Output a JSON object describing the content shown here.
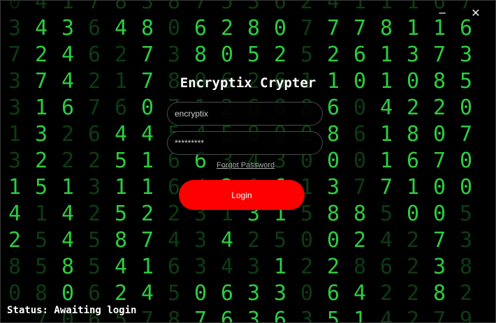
{
  "window": {
    "minimize_glyph": "─",
    "close_glyph": "✕"
  },
  "app": {
    "title": "Encryptix Crypter"
  },
  "form": {
    "username_value": "encryptix",
    "password_value": "*********",
    "forgot_label": "Forgot Password",
    "login_label": "Login"
  },
  "status": {
    "text": "Status: Awaiting login"
  },
  "background": {
    "style": "matrix digital rain",
    "colors": {
      "bright": "#2ecc40",
      "mid": "#1f8a2c",
      "dim": "#0d3b12",
      "faint": "#081f0b"
    },
    "columns": [
      {
        "glyphs": [
          "0",
          "3",
          "7",
          "3",
          "3",
          "1",
          "3",
          "1",
          "4",
          "2",
          "8",
          "0"
        ],
        "levels": [
          "f",
          "d",
          "d",
          "d",
          "d",
          "d",
          "d",
          "b",
          "b",
          "b",
          "d",
          "d"
        ]
      },
      {
        "glyphs": [
          "4",
          "4",
          "2",
          "7",
          "1",
          "3",
          "2",
          "5",
          "1",
          "5",
          "5",
          "8",
          "7"
        ],
        "levels": [
          "d",
          "b",
          "b",
          "b",
          "b",
          "b",
          "b",
          "b",
          "d",
          "d",
          "d",
          "d",
          "d"
        ]
      },
      {
        "glyphs": [
          "1",
          "3",
          "4",
          "4",
          "6",
          "2",
          "2",
          "1",
          "4",
          "4",
          "8",
          "0",
          "0"
        ],
        "levels": [
          "d",
          "b",
          "b",
          "b",
          "b",
          "d",
          "d",
          "b",
          "b",
          "b",
          "b",
          "b",
          "d"
        ]
      },
      {
        "glyphs": [
          "7",
          "6",
          "6",
          "2",
          "7",
          "6",
          "2",
          "3",
          "2",
          "5",
          "5",
          "6",
          "6"
        ],
        "levels": [
          "d",
          "d",
          "d",
          "d",
          "d",
          "d",
          "d",
          "d",
          "d",
          "d",
          "d",
          "d",
          "d"
        ]
      },
      {
        "glyphs": [
          "8",
          "4",
          "2",
          "1",
          "6",
          "4",
          "5",
          "1",
          "5",
          "8",
          "4",
          "2",
          "5"
        ],
        "levels": [
          "d",
          "b",
          "d",
          "d",
          "d",
          "b",
          "b",
          "b",
          "b",
          "b",
          "b",
          "b",
          "d"
        ]
      },
      {
        "glyphs": [
          "3",
          "8",
          "7",
          "7",
          "0",
          "4",
          "1",
          "1",
          "2",
          "7",
          "1",
          "4",
          "7"
        ],
        "levels": [
          "d",
          "b",
          "b",
          "b",
          "b",
          "b",
          "b",
          "b",
          "b",
          "b",
          "b",
          "b",
          "d"
        ]
      },
      {
        "glyphs": [
          "8",
          "0",
          "3",
          "8",
          "7",
          "5",
          "6",
          "6",
          "2",
          "4",
          "6",
          "5",
          "8"
        ],
        "levels": [
          "d",
          "d",
          "d",
          "d",
          "d",
          "d",
          "d",
          "d",
          "d",
          "d",
          "d",
          "d",
          "d"
        ]
      },
      {
        "glyphs": [
          "7",
          "6",
          "8",
          "0",
          "1",
          "4",
          "6",
          "4",
          "3",
          "3",
          "3",
          "0",
          "7"
        ],
        "levels": [
          "d",
          "b",
          "b",
          "d",
          "d",
          "d",
          "b",
          "d",
          "d",
          "d",
          "d",
          "b",
          "b"
        ]
      },
      {
        "glyphs": [
          "5",
          "2",
          "0",
          "6",
          "2",
          "5",
          "3",
          "2",
          "1",
          "4",
          "4",
          "6",
          "6"
        ],
        "levels": [
          "d",
          "b",
          "b",
          "d",
          "d",
          "d",
          "d",
          "b",
          "d",
          "b",
          "d",
          "b",
          "b"
        ]
      },
      {
        "glyphs": [
          "3",
          "8",
          "5",
          "2",
          "6",
          "8",
          "4",
          "0",
          "3",
          "2",
          "3",
          "3",
          "3"
        ],
        "levels": [
          "d",
          "b",
          "b",
          "d",
          "d",
          "d",
          "d",
          "d",
          "b",
          "d",
          "d",
          "b",
          "b"
        ]
      },
      {
        "glyphs": [
          "6",
          "0",
          "2",
          "6",
          "8",
          "0",
          "3",
          "6",
          "1",
          "5",
          "1",
          "3",
          "6"
        ],
        "levels": [
          "d",
          "b",
          "b",
          "d",
          "d",
          "d",
          "d",
          "b",
          "b",
          "d",
          "b",
          "b",
          "b"
        ]
      },
      {
        "glyphs": [
          "2",
          "7",
          "5",
          "1",
          "8",
          "0",
          "0",
          "1",
          "5",
          "0",
          "2",
          "0",
          "3"
        ],
        "levels": [
          "d",
          "d",
          "d",
          "d",
          "d",
          "d",
          "d",
          "d",
          "d",
          "d",
          "d",
          "d",
          "d"
        ]
      },
      {
        "glyphs": [
          "4",
          "7",
          "2",
          "1",
          "6",
          "8",
          "0",
          "3",
          "8",
          "0",
          "2",
          "6",
          "5"
        ],
        "levels": [
          "d",
          "b",
          "b",
          "b",
          "b",
          "b",
          "b",
          "b",
          "b",
          "b",
          "b",
          "b",
          "b"
        ]
      },
      {
        "glyphs": [
          "1",
          "7",
          "6",
          "0",
          "0",
          "6",
          "0",
          "7",
          "8",
          "2",
          "8",
          "4",
          "1"
        ],
        "levels": [
          "d",
          "b",
          "b",
          "b",
          "d",
          "d",
          "d",
          "d",
          "b",
          "b",
          "d",
          "b",
          "b"
        ]
      },
      {
        "glyphs": [
          "1",
          "8",
          "1",
          "1",
          "4",
          "1",
          "1",
          "7",
          "5",
          "4",
          "6",
          "2",
          "4"
        ],
        "levels": [
          "d",
          "b",
          "b",
          "b",
          "b",
          "b",
          "b",
          "b",
          "d",
          "d",
          "d",
          "d",
          "d"
        ]
      },
      {
        "glyphs": [
          "1",
          "1",
          "3",
          "0",
          "2",
          "8",
          "6",
          "1",
          "0",
          "2",
          "2",
          "2",
          "2"
        ],
        "levels": [
          "d",
          "b",
          "b",
          "b",
          "b",
          "b",
          "b",
          "b",
          "b",
          "d",
          "d",
          "d",
          "d"
        ]
      },
      {
        "glyphs": [
          "6",
          "1",
          "7",
          "8",
          "2",
          "0",
          "7",
          "0",
          "0",
          "7",
          "3",
          "8",
          "7"
        ],
        "levels": [
          "d",
          "b",
          "b",
          "b",
          "b",
          "b",
          "b",
          "b",
          "b",
          "b",
          "b",
          "b",
          "d"
        ]
      },
      {
        "glyphs": [
          "7",
          "6",
          "3",
          "5",
          "0",
          "7",
          "0",
          "0",
          "5",
          "3",
          "8",
          "2",
          "9"
        ],
        "levels": [
          "d",
          "b",
          "b",
          "b",
          "b",
          "b",
          "b",
          "b",
          "d",
          "d",
          "d",
          "d",
          "d"
        ]
      }
    ]
  }
}
